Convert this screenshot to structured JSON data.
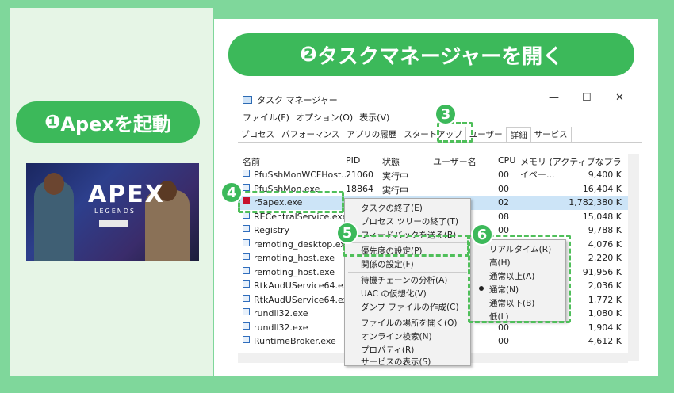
{
  "step1": {
    "number": "❶",
    "label": "Apexを起動"
  },
  "step2": {
    "number": "❷",
    "label": "タスクマネージャーを開く"
  },
  "apex_image": {
    "logo": "APEX",
    "subtitle": "LEGENDS"
  },
  "window": {
    "title": "タスク マネージャー",
    "minimize": "—",
    "maximize": "☐",
    "close": "✕"
  },
  "menu": [
    "ファイル(F)",
    "オプション(O)",
    "表示(V)"
  ],
  "tabs": [
    "プロセス",
    "パフォーマンス",
    "アプリの履歴",
    "スタートアップ",
    "ユーザー",
    "詳細",
    "サービス"
  ],
  "columns": {
    "name": "名前",
    "pid": "PID",
    "status": "状態",
    "user": "ユーザー名",
    "cpu": "CPU",
    "mem": "メモリ (アクティブなプライベー..."
  },
  "rows": [
    {
      "name": "PfuSshMonWCFHost...",
      "pid": "21060",
      "status": "実行中",
      "cpu": "00",
      "mem": "9,400 K"
    },
    {
      "name": "PfuSshMon.exe",
      "pid": "18864",
      "status": "実行中",
      "cpu": "00",
      "mem": "16,404 K"
    },
    {
      "name": "r5apex.exe",
      "pid": "",
      "status": "",
      "cpu": "02",
      "mem": "1,782,380 K"
    },
    {
      "name": "RECentralService.exe",
      "pid": "",
      "status": "",
      "cpu": "08",
      "mem": "15,048 K"
    },
    {
      "name": "Registry",
      "pid": "",
      "status": "",
      "cpu": "00",
      "mem": "9,788 K"
    },
    {
      "name": "remoting_desktop.exe",
      "pid": "",
      "status": "",
      "cpu": "00",
      "mem": "4,076 K"
    },
    {
      "name": "remoting_host.exe",
      "pid": "",
      "status": "",
      "cpu": "00",
      "mem": "2,220 K"
    },
    {
      "name": "remoting_host.exe",
      "pid": "",
      "status": "",
      "cpu": "00",
      "mem": "91,956 K"
    },
    {
      "name": "RtkAudUService64.exe",
      "pid": "",
      "status": "",
      "cpu": "00",
      "mem": "2,036 K"
    },
    {
      "name": "RtkAudUService64.exe",
      "pid": "",
      "status": "",
      "cpu": "00",
      "mem": "1,772 K"
    },
    {
      "name": "rundll32.exe",
      "pid": "",
      "status": "",
      "cpu": "00",
      "mem": "1,080 K"
    },
    {
      "name": "rundll32.exe",
      "pid": "",
      "status": "",
      "cpu": "00",
      "mem": "1,904 K"
    },
    {
      "name": "RuntimeBroker.exe",
      "pid": "",
      "status": "",
      "cpu": "00",
      "mem": "4,612 K"
    }
  ],
  "context_menu": [
    "タスクの終了(E)",
    "プロセス ツリーの終了(T)",
    "フィードバックを送る(B)",
    "優先度の設定(P)",
    "関係の設定(F)",
    "待機チェーンの分析(A)",
    "UAC の仮想化(V)",
    "ダンプ ファイルの作成(C)",
    "ファイルの場所を開く(O)",
    "オンライン検索(N)",
    "プロパティ(R)",
    "サービスの表示(S)"
  ],
  "priority_menu": [
    "リアルタイム(R)",
    "高(H)",
    "通常以上(A)",
    "通常(N)",
    "通常以下(B)",
    "低(L)"
  ],
  "priority_selected": "通常(N)",
  "steps": {
    "s3": "3",
    "s4": "4",
    "s5": "5",
    "s6": "6"
  },
  "colors": {
    "accent": "#3cb95a",
    "background": "#7fd79b",
    "selection": "#cce4f7"
  }
}
